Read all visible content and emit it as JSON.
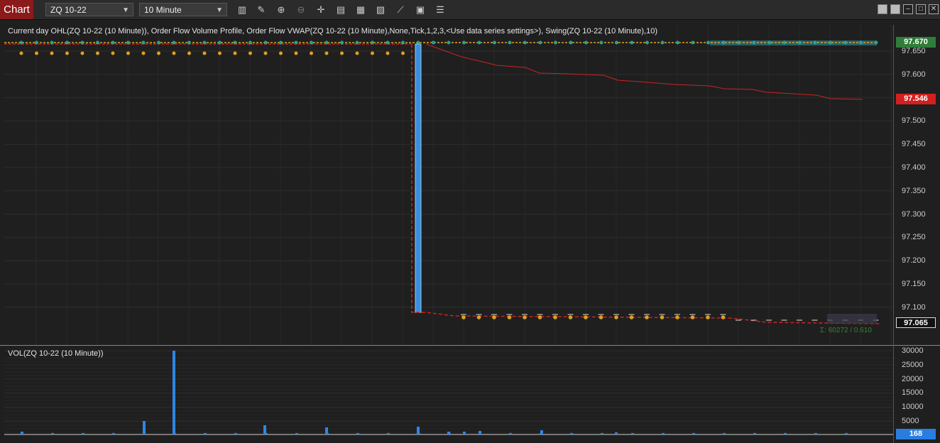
{
  "toolbar": {
    "tab_label": "Chart",
    "instrument": "ZQ 10-22",
    "interval": "10 Minute",
    "tools": [
      "bar-type-icon",
      "draw-pencil-icon",
      "zoom-in-icon",
      "zoom-out-icon",
      "crosshair-icon",
      "properties-icon",
      "templates-icon",
      "indicators-icon",
      "strategies-icon",
      "data-box-icon",
      "list-icon"
    ]
  },
  "window_controls": [
    "tile-icon",
    "tile-icon",
    "minimize-icon",
    "maximize-icon",
    "close-icon"
  ],
  "panel_main": {
    "title": "Current day OHL(ZQ 10-22 (10 Minute)), Order Flow Volume Profile, Order Flow VWAP(ZQ 10-22 (10 Minute),None,Tick,1,2,3,<Use data series settings>), Swing(ZQ 10-22 (10 Minute),10)",
    "y_ticks": [
      "97.650",
      "97.600",
      "97.550",
      "97.500",
      "97.450",
      "97.400",
      "97.350",
      "97.300",
      "97.250",
      "97.200",
      "97.150",
      "97.100"
    ],
    "tags": {
      "top": "97.670",
      "vwap": "97.546",
      "last": "97.065"
    },
    "stat": "Σ: 60272 / 0.610"
  },
  "panel_volume": {
    "title": "VOL(ZQ 10-22 (10 Minute))",
    "y_ticks": [
      "30000",
      "25000",
      "20000",
      "15000",
      "10000",
      "5000"
    ],
    "last_tag": "168"
  },
  "colors": {
    "up": "#3b8ee0",
    "vwap": "#cc2222",
    "swing": "#e0a020",
    "teal": "#2aa198",
    "tag_green": "#2f7d3a",
    "tag_red": "#d21f1f"
  }
}
